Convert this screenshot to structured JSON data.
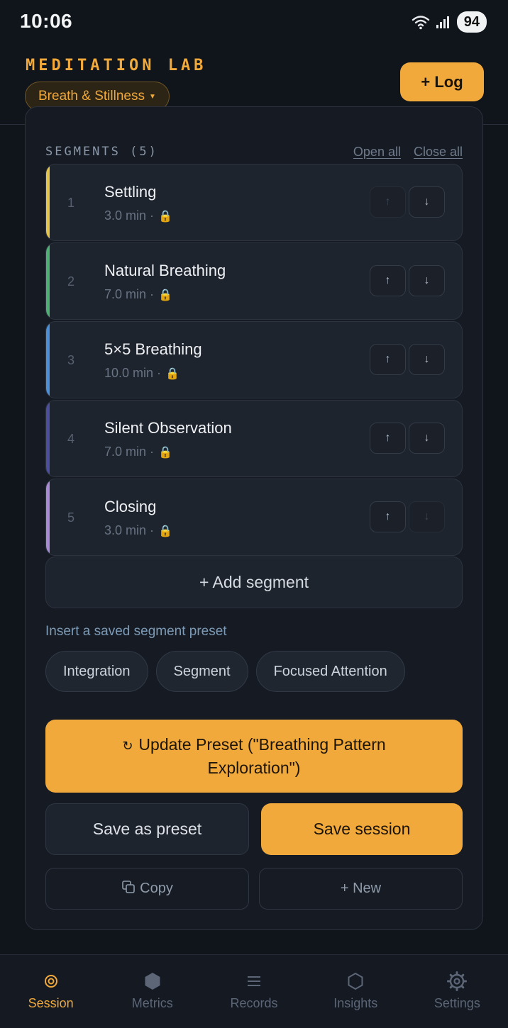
{
  "status_bar": {
    "time": "10:06",
    "battery": "94",
    "wifi_label": "6"
  },
  "header": {
    "title": "MEDITATION LAB",
    "profile_selector": "Breath & Stillness",
    "log_button": "+ Log"
  },
  "segments_section": {
    "title": "SEGMENTS (5)",
    "open_all": "Open all",
    "close_all": "Close all",
    "items": [
      {
        "number": "1",
        "name": "Settling",
        "duration": "3.0 min ·",
        "accent": "#e4c44a",
        "up_enabled": false,
        "down_enabled": true
      },
      {
        "number": "2",
        "name": "Natural Breathing",
        "duration": "7.0 min ·",
        "accent": "#4faf74",
        "up_enabled": true,
        "down_enabled": true
      },
      {
        "number": "3",
        "name": "5×5 Breathing",
        "duration": "10.0 min ·",
        "accent": "#4c8fd6",
        "up_enabled": true,
        "down_enabled": true
      },
      {
        "number": "4",
        "name": "Silent Observation",
        "duration": "7.0 min ·",
        "accent": "#4d4f9c",
        "up_enabled": true,
        "down_enabled": true
      },
      {
        "number": "5",
        "name": "Closing",
        "duration": "3.0 min ·",
        "accent": "#a98bd4",
        "up_enabled": true,
        "down_enabled": false
      }
    ],
    "add_segment": "+ Add segment"
  },
  "presets": {
    "label": "Insert a saved segment preset",
    "chips": [
      "Integration",
      "Segment",
      "Focused Attention"
    ]
  },
  "actions": {
    "update_preset": "Update Preset (\"Breathing Pattern Exploration\")",
    "save_as_preset": "Save as preset",
    "save_session": "Save session",
    "copy": "Copy",
    "new": "+ New"
  },
  "bottom_nav": {
    "items": [
      {
        "label": "Session",
        "icon": "target-icon",
        "active": true
      },
      {
        "label": "Metrics",
        "icon": "hexagon-filled-icon",
        "active": false
      },
      {
        "label": "Records",
        "icon": "list-icon",
        "active": false
      },
      {
        "label": "Insights",
        "icon": "hexagon-outline-icon",
        "active": false
      },
      {
        "label": "Settings",
        "icon": "gear-icon",
        "active": false
      }
    ]
  },
  "colors": {
    "accent": "#f2a93b",
    "background": "#10141b",
    "card": "#161b23"
  }
}
